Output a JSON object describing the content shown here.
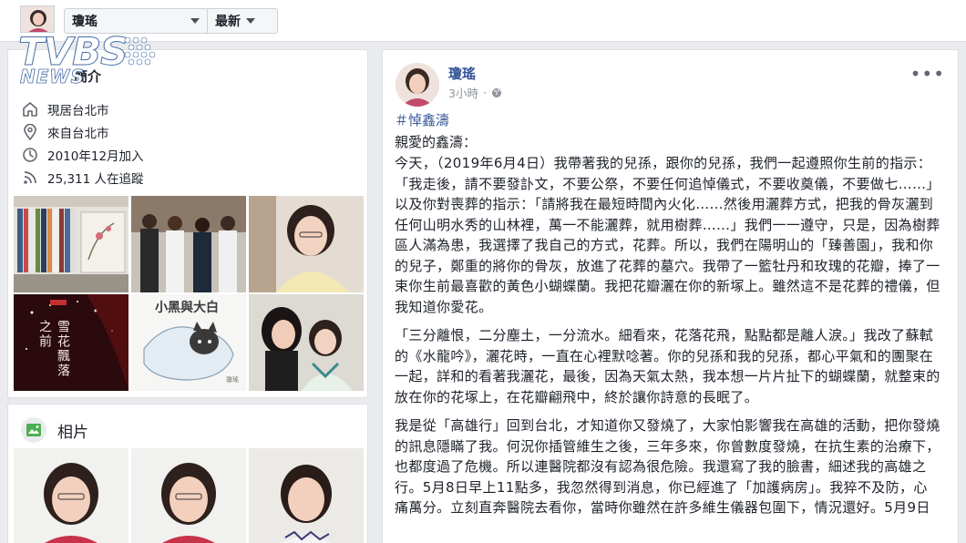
{
  "topbar": {
    "page_name": "瓊瑤",
    "filter_label": "最新"
  },
  "watermark": {
    "main": "TVBS",
    "sub": "NEWS"
  },
  "about": {
    "title": "簡介",
    "lives_in": "現居台北市",
    "from": "來自台北市",
    "joined": "2010年12月加入",
    "followers": "25,311 人在追蹤"
  },
  "photo_tiles": {
    "book_title": "小黑與大白",
    "novel_title": "雪花飄落之前"
  },
  "photos": {
    "title": "相片"
  },
  "post": {
    "author": "瓊瑤",
    "time": "3小時",
    "hashtag": "＃悼鑫濤",
    "greeting": "親愛的鑫濤：",
    "paragraphs": [
      "今天，（2019年6月4日）我帶著我的兒孫，跟你的兒孫，我們一起遵照你生前的指示：「我走後，請不要發訃文，不要公祭，不要任何追悼儀式，不要收奠儀，不要做七……」以及你對喪葬的指示：「請將我在最短時間內火化……然後用灑葬方式，把我的骨灰灑到任何山明水秀的山林裡，萬一不能灑葬，就用樹葬……」我們一一遵守，只是，因為樹葬區人滿為患，我選擇了我自己的方式，花葬。所以，我們在陽明山的「臻善園」，我和你的兒子，鄭重的將你的骨灰，放進了花葬的墓穴。我帶了一籃牡丹和玫瑰的花瓣，捧了一束你生前最喜歡的黃色小蝴蝶蘭。我把花瓣灑在你的新塚上。雖然這不是花葬的禮儀，但我知道你愛花。",
      "「三分離恨，二分塵土，一分流水。細看來，花落花飛，點點都是離人淚。」我改了蘇軾的《水龍吟》，灑花時，一直在心裡默唸著。你的兒孫和我的兒孫，都心平氣和的團聚在一起，詳和的看著我灑花，最後，因為天氣太熱，我本想一片片扯下的蝴蝶蘭，就整束的放在你的花塚上，在花瓣翩飛中，終於讓你詩意的長眠了。",
      "我是從「高雄行」回到台北，才知道你又發燒了，大家怕影響我在高雄的活動，把你發燒的訊息隱瞞了我。何況你插管維生之後，三年多來，你曾數度發燒，在抗生素的治療下，也都度過了危機。所以連醫院都沒有認為很危險。我還寫了我的臉書，細述我的高雄之行。5月8日早上11點多，我忽然得到消息，你已經進了「加護病房」。我猝不及防，心痛萬分。立刻直奔醫院去看你，當時你雖然在許多維生儀器包圍下，情況還好。5月9日"
    ]
  }
}
